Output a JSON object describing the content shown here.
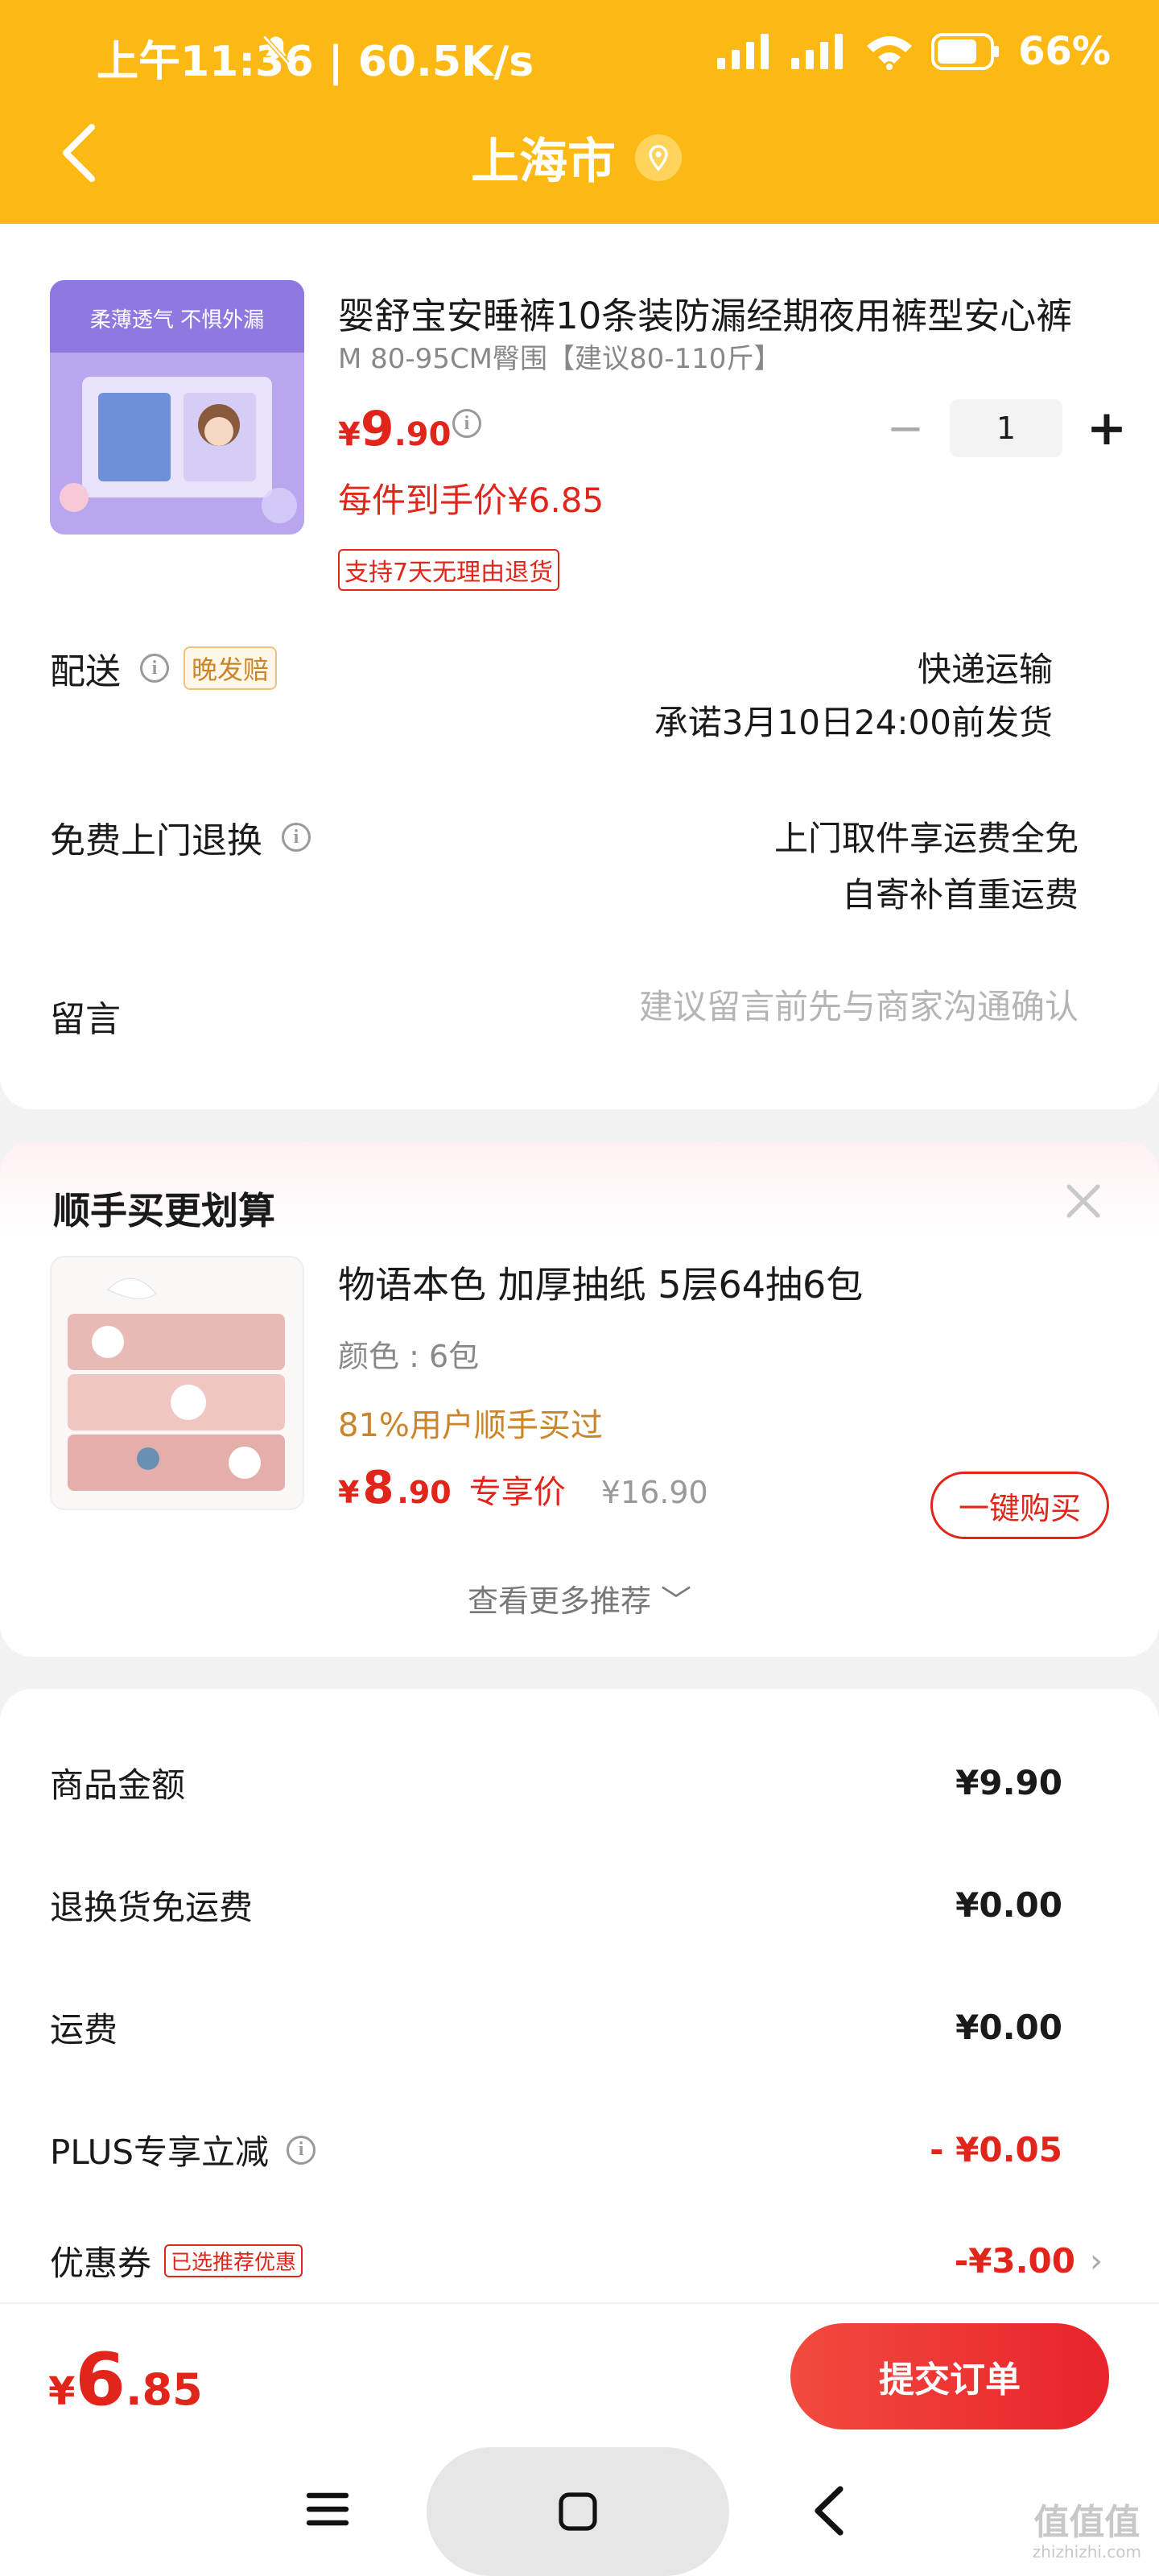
{
  "status_bar": {
    "time": "上午11:36 | 60.5K/s",
    "battery": "66%"
  },
  "nav": {
    "title": "上海市"
  },
  "product": {
    "title": "婴舒宝安睡裤10条装防漏经期夜用裤型安心裤",
    "spec": "M 80-95CM臀围【建议80-110斤】",
    "price_symbol": "¥",
    "price_int": "9",
    "price_dec": ".90",
    "net_price": "每件到手价¥6.85",
    "return_tag": "支持7天无理由退货",
    "quantity": "1",
    "image_caption": "柔薄透气 不惧外漏"
  },
  "delivery": {
    "label": "配送",
    "late_tag": "晚发赔",
    "method": "快递运输",
    "promise": "承诺3月10日24:00前发货"
  },
  "free_return": {
    "label": "免费上门退换",
    "line1": "上门取件享运费全免",
    "line2": "自寄补首重运费"
  },
  "memo": {
    "label": "留言",
    "placeholder": "建议留言前先与商家沟通确认"
  },
  "recommend": {
    "title": "顺手买更划算",
    "name": "物语本色 加厚抽纸 5层64抽6包",
    "spec": "颜色 : 6包",
    "buyers": "81%用户顺手买过",
    "price_symbol": "¥",
    "price_int": "8",
    "price_dec": ".90",
    "price_label": "专享价",
    "original_price": "¥16.90",
    "buy_label": "一键购买",
    "more_label": "查看更多推荐 ﹀"
  },
  "summary": {
    "rows": [
      {
        "label": "商品金额",
        "value": "¥9.90"
      },
      {
        "label": "退换货免运费",
        "value": "¥0.00"
      },
      {
        "label": "运费",
        "value": "¥0.00"
      },
      {
        "label": "PLUS专享立减",
        "value": "- ¥0.05"
      },
      {
        "label": "优惠券",
        "value": "-¥3.00",
        "tag": "已选推荐优惠"
      }
    ]
  },
  "bottom": {
    "total_symbol": "¥",
    "total_int": "6",
    "total_dec": ".85",
    "submit_label": "提交订单"
  },
  "watermark": {
    "text": "值值值",
    "sub": "zhizhizhi.com"
  },
  "colors": {
    "header": "#fdb913",
    "price_red": "#e1251b",
    "accent_orange": "#c9852a"
  }
}
